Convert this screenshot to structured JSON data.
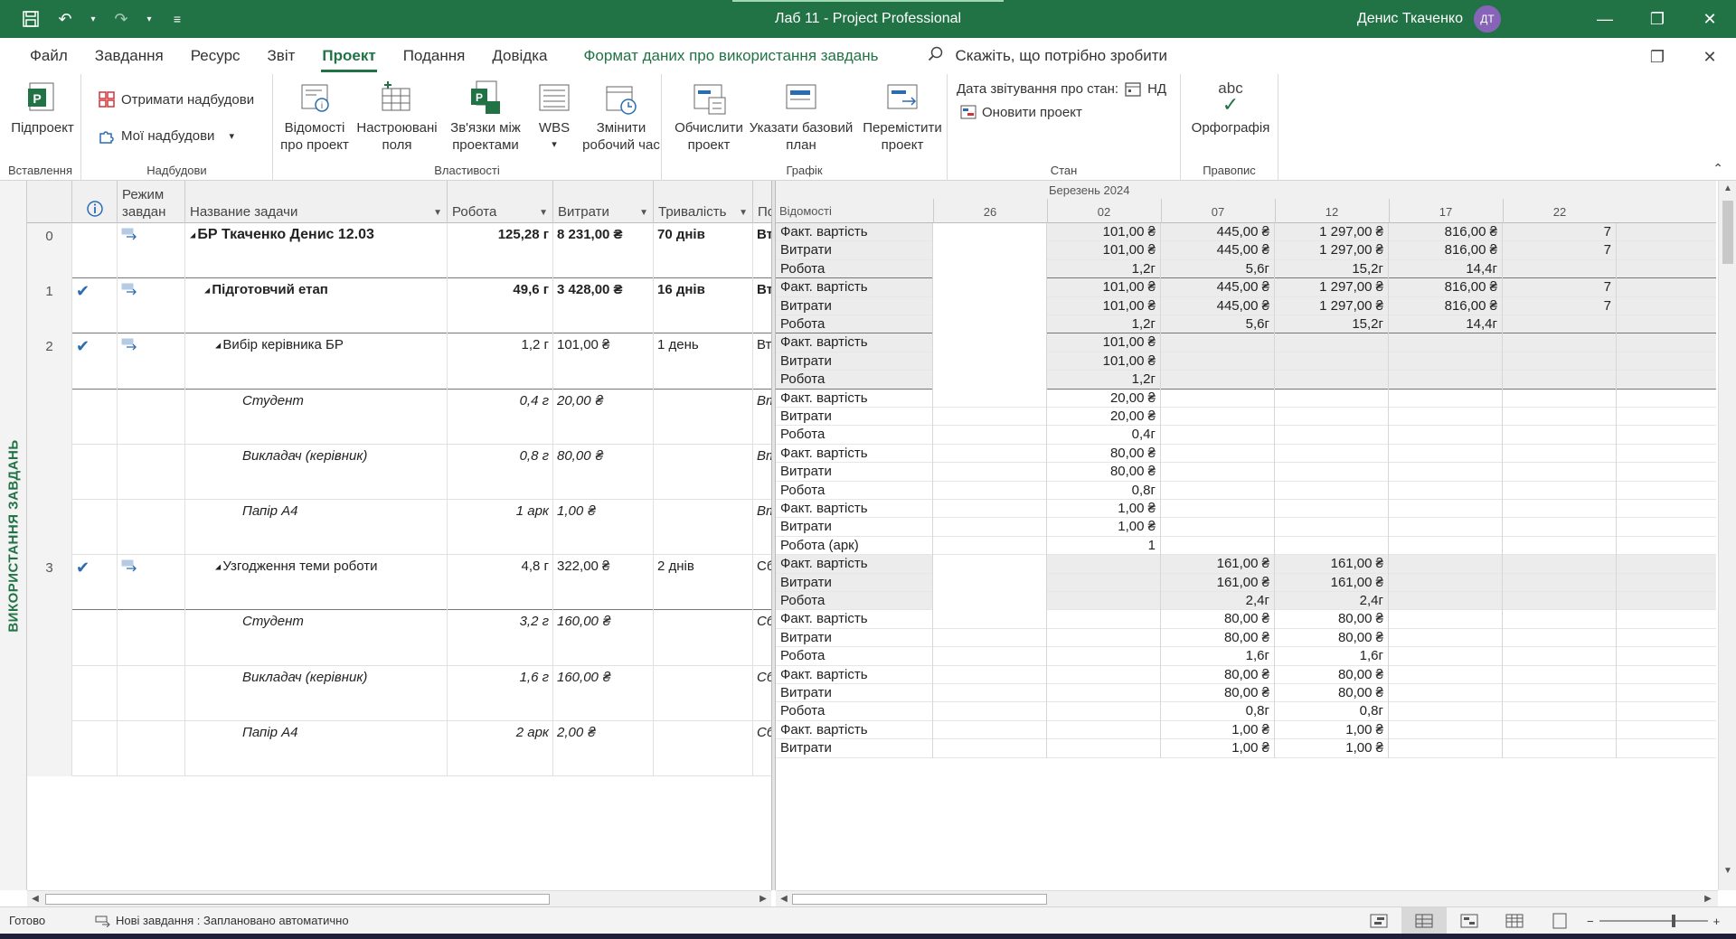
{
  "titlebar": {
    "title": "Лаб 11  -  Project Professional",
    "user_name": "Денис Ткаченко",
    "user_initials": "ДТ"
  },
  "menu": {
    "tabs": [
      "Файл",
      "Завдання",
      "Ресурс",
      "Звіт",
      "Проект",
      "Подання",
      "Довідка"
    ],
    "context_tab": "Формат даних про використання завдань",
    "search_placeholder": "Скажіть, що потрібно зробити"
  },
  "ribbon": {
    "insert": {
      "label": "Вставлення",
      "subproject": "Підпроект"
    },
    "addins": {
      "label": "Надбудови",
      "get_addins": "Отримати надбудови",
      "my_addins": "Мої надбудови"
    },
    "properties": {
      "label": "Властивості",
      "project_info": "Відомості\nпро проект",
      "custom_fields": "Настроювані\nполя",
      "links": "Зв'язки між\nпроектами",
      "wbs": "WBS",
      "change_time": "Змінити\nробочий час"
    },
    "schedule": {
      "label": "Графік",
      "calculate": "Обчислити\nпроект",
      "baseline": "Указати базовий\nплан",
      "move": "Перемістити\nпроект"
    },
    "status": {
      "label": "Стан",
      "status_date_label": "Дата звітування про стан:",
      "status_date_value": "НД",
      "update_project": "Оновити проект"
    },
    "proofing": {
      "label": "Правопис",
      "spelling": "Орфографія",
      "abc": "abc"
    }
  },
  "view_label": "ВИКОРИСТАННЯ ЗАВДАНЬ",
  "table": {
    "headers": {
      "mode": "Режим\nзавдан",
      "name": "Название задачи",
      "work": "Робота",
      "cost": "Витрати",
      "duration": "Тривалість",
      "start": "Поча"
    },
    "rows": [
      {
        "id": "0",
        "done": false,
        "name": "БР Ткаченко Денис 12.03",
        "work": "125,28 г",
        "cost": "8 231,00 ₴",
        "duration": "70 днів",
        "start": "Вт",
        "level": 0,
        "type": "summary"
      },
      {
        "id": "1",
        "done": true,
        "name": "Підготовчий етап",
        "work": "49,6 г",
        "cost": "3 428,00 ₴",
        "duration": "16 днів",
        "start": "Вт",
        "level": 1,
        "type": "summary"
      },
      {
        "id": "2",
        "done": true,
        "name": "Вибір керівника БР",
        "work": "1,2 г",
        "cost": "101,00 ₴",
        "duration": "1 день",
        "start": "Вт",
        "level": 2,
        "type": "task"
      },
      {
        "id": "",
        "done": false,
        "name": "Студент",
        "work": "0,4 г",
        "cost": "20,00 ₴",
        "duration": "",
        "start": "Вт",
        "level": 3,
        "type": "resource"
      },
      {
        "id": "",
        "done": false,
        "name": "Викладач (керівник)",
        "work": "0,8 г",
        "cost": "80,00 ₴",
        "duration": "",
        "start": "Вт",
        "level": 3,
        "type": "resource"
      },
      {
        "id": "",
        "done": false,
        "name": "Папір А4",
        "work": "1 арк",
        "cost": "1,00 ₴",
        "duration": "",
        "start": "Вт",
        "level": 3,
        "type": "resource"
      },
      {
        "id": "3",
        "done": true,
        "name": "Узгодження теми роботи",
        "work": "4,8 г",
        "cost": "322,00 ₴",
        "duration": "2 днів",
        "start": "Сб",
        "level": 2,
        "type": "task"
      },
      {
        "id": "",
        "done": false,
        "name": "Студент",
        "work": "3,2 г",
        "cost": "160,00 ₴",
        "duration": "",
        "start": "Сб",
        "level": 3,
        "type": "resource"
      },
      {
        "id": "",
        "done": false,
        "name": "Викладач (керівник)",
        "work": "1,6 г",
        "cost": "160,00 ₴",
        "duration": "",
        "start": "Сб",
        "level": 3,
        "type": "resource"
      },
      {
        "id": "",
        "done": false,
        "name": "Папір А4",
        "work": "2 арк",
        "cost": "2,00 ₴",
        "duration": "",
        "start": "Сб",
        "level": 3,
        "type": "resource"
      }
    ]
  },
  "usage": {
    "details_header": "Відомості",
    "month": "Березень 2024",
    "days": [
      "26",
      "02",
      "07",
      "12",
      "17",
      "22"
    ],
    "lines": [
      {
        "label": "Факт. вартість",
        "vals": [
          "",
          "101,00 ₴",
          "445,00 ₴",
          "1 297,00 ₴",
          "816,00 ₴",
          "7"
        ],
        "shade": true
      },
      {
        "label": "Витрати",
        "vals": [
          "",
          "101,00 ₴",
          "445,00 ₴",
          "1 297,00 ₴",
          "816,00 ₴",
          "7"
        ],
        "shade": true
      },
      {
        "label": "Робота",
        "vals": [
          "",
          "1,2г",
          "5,6г",
          "15,2г",
          "14,4г",
          ""
        ],
        "shade": true,
        "sep": true
      },
      {
        "label": "Факт. вартість",
        "vals": [
          "",
          "101,00 ₴",
          "445,00 ₴",
          "1 297,00 ₴",
          "816,00 ₴",
          "7"
        ],
        "shade": true
      },
      {
        "label": "Витрати",
        "vals": [
          "",
          "101,00 ₴",
          "445,00 ₴",
          "1 297,00 ₴",
          "816,00 ₴",
          "7"
        ],
        "shade": true
      },
      {
        "label": "Робота",
        "vals": [
          "",
          "1,2г",
          "5,6г",
          "15,2г",
          "14,4г",
          ""
        ],
        "shade": true,
        "sep": true
      },
      {
        "label": "Факт. вартість",
        "vals": [
          "",
          "101,00 ₴",
          "",
          "",
          "",
          ""
        ],
        "shade": true
      },
      {
        "label": "Витрати",
        "vals": [
          "",
          "101,00 ₴",
          "",
          "",
          "",
          ""
        ],
        "shade": true
      },
      {
        "label": "Робота",
        "vals": [
          "",
          "1,2г",
          "",
          "",
          "",
          ""
        ],
        "shade": true,
        "sep": true
      },
      {
        "label": "Факт. вартість",
        "vals": [
          "",
          "20,00 ₴",
          "",
          "",
          "",
          ""
        ]
      },
      {
        "label": "Витрати",
        "vals": [
          "",
          "20,00 ₴",
          "",
          "",
          "",
          ""
        ]
      },
      {
        "label": "Робота",
        "vals": [
          "",
          "0,4г",
          "",
          "",
          "",
          ""
        ]
      },
      {
        "label": "Факт. вартість",
        "vals": [
          "",
          "80,00 ₴",
          "",
          "",
          "",
          ""
        ]
      },
      {
        "label": "Витрати",
        "vals": [
          "",
          "80,00 ₴",
          "",
          "",
          "",
          ""
        ]
      },
      {
        "label": "Робота",
        "vals": [
          "",
          "0,8г",
          "",
          "",
          "",
          ""
        ]
      },
      {
        "label": "Факт. вартість",
        "vals": [
          "",
          "1,00 ₴",
          "",
          "",
          "",
          ""
        ]
      },
      {
        "label": "Витрати",
        "vals": [
          "",
          "1,00 ₴",
          "",
          "",
          "",
          ""
        ]
      },
      {
        "label": "Робота (арк)",
        "vals": [
          "",
          "1",
          "",
          "",
          "",
          ""
        ]
      },
      {
        "label": "Факт. вартість",
        "vals": [
          "",
          "",
          "161,00 ₴",
          "161,00 ₴",
          "",
          ""
        ],
        "shade": true
      },
      {
        "label": "Витрати",
        "vals": [
          "",
          "",
          "161,00 ₴",
          "161,00 ₴",
          "",
          ""
        ],
        "shade": true
      },
      {
        "label": "Робота",
        "vals": [
          "",
          "",
          "2,4г",
          "2,4г",
          "",
          ""
        ],
        "shade": true
      },
      {
        "label": "Факт. вартість",
        "vals": [
          "",
          "",
          "80,00 ₴",
          "80,00 ₴",
          "",
          ""
        ]
      },
      {
        "label": "Витрати",
        "vals": [
          "",
          "",
          "80,00 ₴",
          "80,00 ₴",
          "",
          ""
        ]
      },
      {
        "label": "Робота",
        "vals": [
          "",
          "",
          "1,6г",
          "1,6г",
          "",
          ""
        ]
      },
      {
        "label": "Факт. вартість",
        "vals": [
          "",
          "",
          "80,00 ₴",
          "80,00 ₴",
          "",
          ""
        ]
      },
      {
        "label": "Витрати",
        "vals": [
          "",
          "",
          "80,00 ₴",
          "80,00 ₴",
          "",
          ""
        ]
      },
      {
        "label": "Робота",
        "vals": [
          "",
          "",
          "0,8г",
          "0,8г",
          "",
          ""
        ]
      },
      {
        "label": "Факт. вартість",
        "vals": [
          "",
          "",
          "1,00 ₴",
          "1,00 ₴",
          "",
          ""
        ]
      },
      {
        "label": "Витрати",
        "vals": [
          "",
          "",
          "1,00 ₴",
          "1,00 ₴",
          "",
          ""
        ]
      }
    ]
  },
  "statusbar": {
    "ready": "Готово",
    "new_tasks": "Нові завдання : Заплановано автоматично"
  },
  "colors": {
    "accent": "#217346",
    "check": "#2b6cb0",
    "avatar": "#8764b8"
  }
}
